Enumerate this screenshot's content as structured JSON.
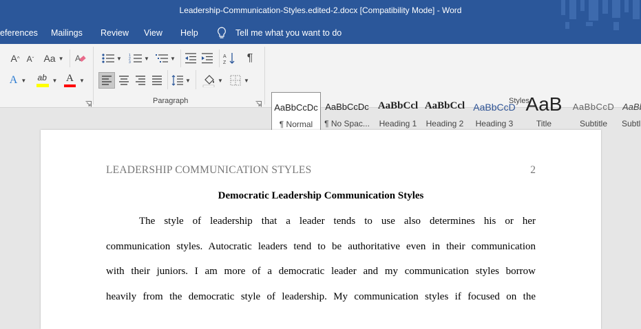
{
  "window": {
    "title": "Leadership-Communication-Styles.edited-2.docx [Compatibility Mode]  -  Word"
  },
  "menu": {
    "references": "eferences",
    "mailings": "Mailings",
    "review": "Review",
    "view": "View",
    "help": "Help",
    "tell_me": "Tell me what you want to do"
  },
  "ribbon": {
    "font_size_up": "A",
    "font_size_down": "A",
    "change_case": "Aa",
    "text_effects": "A",
    "highlight_text": "ab",
    "font_color_letter": "A",
    "paragraph_label": "Paragraph",
    "styles_label": "Styles",
    "colors": {
      "highlight": "#ffff00",
      "font_color": "#ff0000",
      "accent": "#2b579a"
    }
  },
  "styles": [
    {
      "preview": "AaBbCcDc",
      "name": "¶ Normal"
    },
    {
      "preview": "AaBbCcDc",
      "name": "¶ No Spac..."
    },
    {
      "preview": "AaBbCcl",
      "name": "Heading 1"
    },
    {
      "preview": "AaBbCcl",
      "name": "Heading 2"
    },
    {
      "preview": "AaBbCcD",
      "name": "Heading 3"
    },
    {
      "preview": "AaB",
      "name": "Title"
    },
    {
      "preview": "AaBbCcD",
      "name": "Subtitle"
    },
    {
      "preview": "AaBb",
      "name": "Subtl"
    }
  ],
  "document": {
    "running_head": "LEADERSHIP COMMUNICATION STYLES",
    "page_number": "2",
    "heading": "Democratic Leadership Communication Styles",
    "lines": [
      "The style of leadership that a leader tends to use also determines his or her",
      "communication styles. Autocratic leaders tend to be authoritative even in their communication",
      "with their juniors. I am more of a democratic leader and my communication styles borrow",
      "heavily from the democratic style of leadership.  My communication styles if focused on the"
    ]
  }
}
